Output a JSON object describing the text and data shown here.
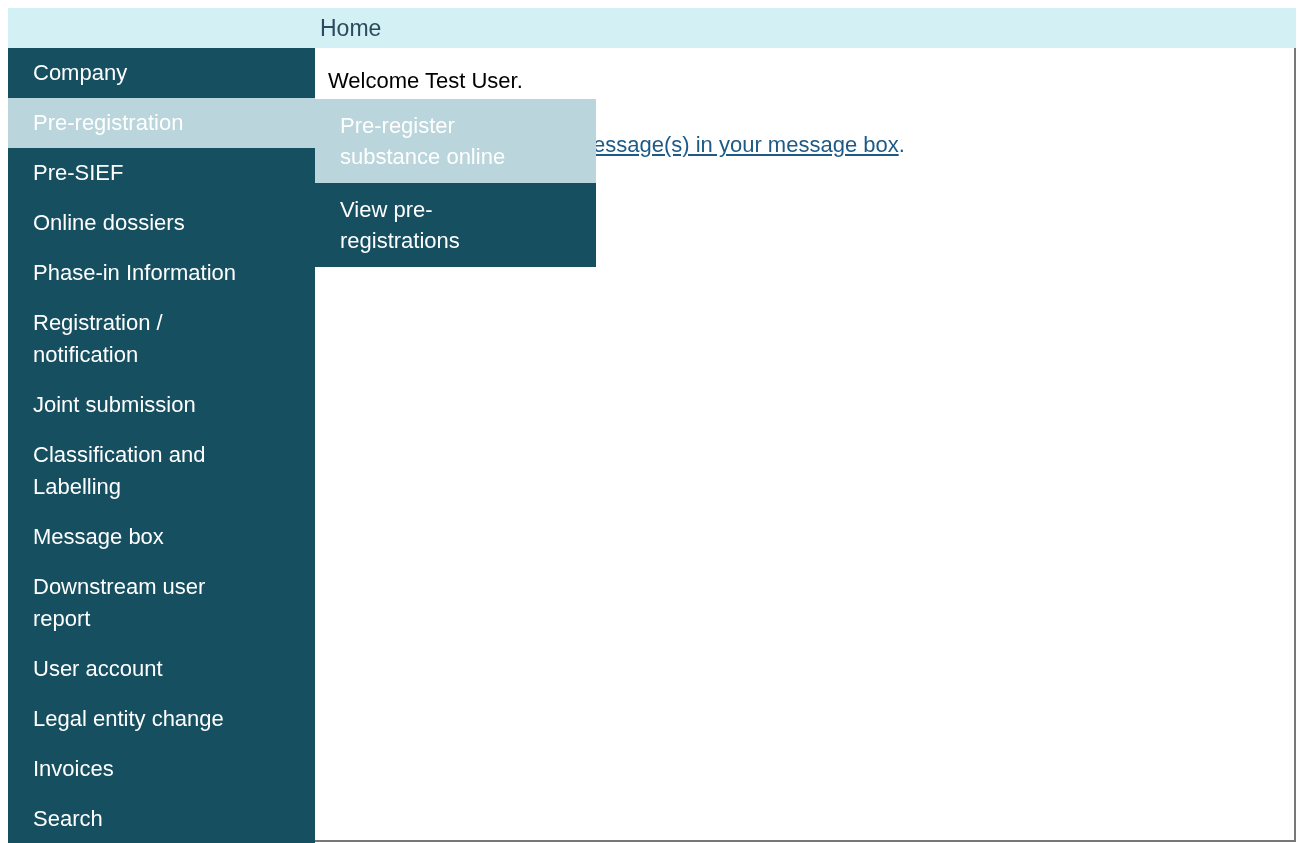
{
  "breadcrumb": {
    "label": "Home"
  },
  "sidebar": {
    "items": [
      {
        "label": "Company",
        "selected": false
      },
      {
        "label": "Pre-registration",
        "selected": true,
        "expanded": true,
        "children": [
          {
            "label": "Pre-register\nsubstance online",
            "selected": true
          },
          {
            "label": "View pre-\nregistrations",
            "selected": false
          }
        ]
      },
      {
        "label": "Pre-SIEF",
        "selected": false
      },
      {
        "label": "Online dossiers",
        "selected": false
      },
      {
        "label": "Phase-in Information",
        "selected": false
      },
      {
        "label": "Registration /\nnotification",
        "selected": false
      },
      {
        "label": "Joint submission",
        "selected": false
      },
      {
        "label": "Classification and\nLabelling",
        "selected": false
      },
      {
        "label": "Message box",
        "selected": false
      },
      {
        "label": "Downstream user\nreport",
        "selected": false
      },
      {
        "label": "User account",
        "selected": false
      },
      {
        "label": "Legal entity change",
        "selected": false
      },
      {
        "label": "Invoices",
        "selected": false
      },
      {
        "label": "Search",
        "selected": false
      }
    ]
  },
  "content": {
    "welcome": "Welcome Test User.",
    "message_link": "essage(s) in your message box",
    "message_end": "."
  }
}
